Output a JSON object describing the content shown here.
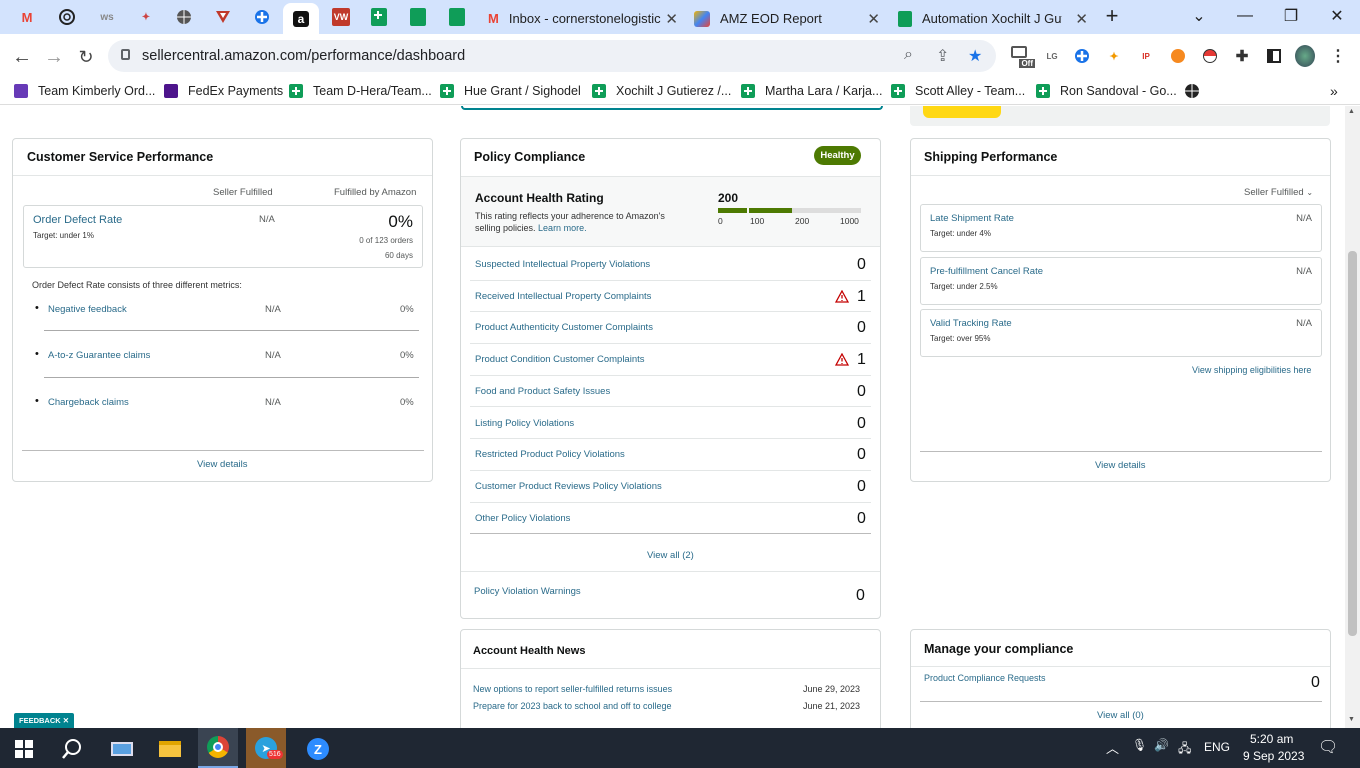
{
  "browser": {
    "tabs": [
      {
        "title": "Inbox - cornerstonelogistic",
        "icon": "gmail-icon"
      },
      {
        "title": "AMZ EOD Report",
        "icon": "tool-icon"
      },
      {
        "title": "Automation Xochilt J Gutie",
        "icon": "sheets-icon"
      }
    ],
    "pinned_icons": [
      "gmail",
      "chatgpt",
      "ws",
      "app",
      "globe",
      "vpn",
      "cross",
      "amazon",
      "wb",
      "sheets",
      "sheets",
      "sheets"
    ],
    "url": "sellercentral.amazon.com/performance/dashboard",
    "ext_off_label": "Off"
  },
  "bookmarks": [
    {
      "label": "Team Kimberly Ord...",
      "icon": "form"
    },
    {
      "label": "FedEx Payments",
      "icon": "fedex"
    },
    {
      "label": "Team D-Hera/Team...",
      "icon": "sheet"
    },
    {
      "label": "Hue Grant / Sighodel",
      "icon": "sheet"
    },
    {
      "label": "Xochilt J Gutierez /...",
      "icon": "sheet"
    },
    {
      "label": "Martha Lara / Karja...",
      "icon": "sheet"
    },
    {
      "label": "Scott Alley - Team...",
      "icon": "sheet"
    },
    {
      "label": "Ron Sandoval - Go...",
      "icon": "sheet"
    }
  ],
  "customer_service": {
    "title": "Customer Service Performance",
    "col_seller": "Seller Fulfilled",
    "col_amazon": "Fulfilled by Amazon",
    "odr_label": "Order Defect Rate",
    "odr_target": "Target: under 1%",
    "odr_seller": "N/A",
    "odr_amazon": "0%",
    "odr_orders": "0 of 123 orders",
    "odr_days": "60 days",
    "consists": "Order Defect Rate consists of three different metrics:",
    "metrics": [
      {
        "label": "Negative feedback",
        "seller": "N/A",
        "amazon": "0%"
      },
      {
        "label": "A-to-z Guarantee claims",
        "seller": "N/A",
        "amazon": "0%"
      },
      {
        "label": "Chargeback claims",
        "seller": "N/A",
        "amazon": "0%"
      }
    ],
    "view_details": "View details"
  },
  "policy": {
    "title": "Policy Compliance",
    "badge": "Healthy",
    "ahr_title": "Account Health Rating",
    "ahr_desc_1": "This rating reflects your adherence to Amazon's",
    "ahr_desc_2": "selling policies.",
    "learn_more": "Learn more.",
    "score": "200",
    "score_value": 200,
    "scale": [
      "0",
      "100",
      "200",
      "1000"
    ],
    "items": [
      {
        "label": "Suspected Intellectual Property Violations",
        "count": "0",
        "warning": false
      },
      {
        "label": "Received Intellectual Property Complaints",
        "count": "1",
        "warning": true
      },
      {
        "label": "Product Authenticity Customer Complaints",
        "count": "0",
        "warning": false
      },
      {
        "label": "Product Condition Customer Complaints",
        "count": "1",
        "warning": true
      },
      {
        "label": "Food and Product Safety Issues",
        "count": "0",
        "warning": false
      },
      {
        "label": "Listing Policy Violations",
        "count": "0",
        "warning": false
      },
      {
        "label": "Restricted Product Policy Violations",
        "count": "0",
        "warning": false
      },
      {
        "label": "Customer Product Reviews Policy Violations",
        "count": "0",
        "warning": false
      },
      {
        "label": "Other Policy Violations",
        "count": "0",
        "warning": false
      }
    ],
    "view_all": "View all (2)",
    "warnings_label": "Policy Violation Warnings",
    "warnings_count": "0"
  },
  "news": {
    "title": "Account Health News",
    "items": [
      {
        "label": "New options to report seller-fulfilled returns issues",
        "date": "June 29, 2023"
      },
      {
        "label": "Prepare for 2023 back to school and off to college",
        "date": "June 21, 2023"
      }
    ]
  },
  "shipping": {
    "title": "Shipping Performance",
    "filter": "Seller Fulfilled",
    "metrics": [
      {
        "label": "Late Shipment Rate",
        "target": "Target: under 4%",
        "value": "N/A"
      },
      {
        "label": "Pre-fulfillment Cancel Rate",
        "target": "Target: under 2.5%",
        "value": "N/A"
      },
      {
        "label": "Valid Tracking Rate",
        "target": "Target: over 95%",
        "value": "N/A"
      }
    ],
    "eligibility": "View shipping eligibilities here",
    "view_details": "View details"
  },
  "compliance": {
    "title": "Manage your compliance",
    "requests_label": "Product Compliance Requests",
    "requests_count": "0",
    "view_all": "View all (0)"
  },
  "feedback": "FEEDBACK",
  "taskbar": {
    "telegram_badge": "516",
    "lang": "ENG",
    "time": "5:20 am",
    "date": "9 Sep 2023"
  },
  "colors": {
    "accent": "#4d7a02",
    "link": "#2a6b8a",
    "tab_bar": "#d3e3fd",
    "taskbar": "#1f2733"
  }
}
